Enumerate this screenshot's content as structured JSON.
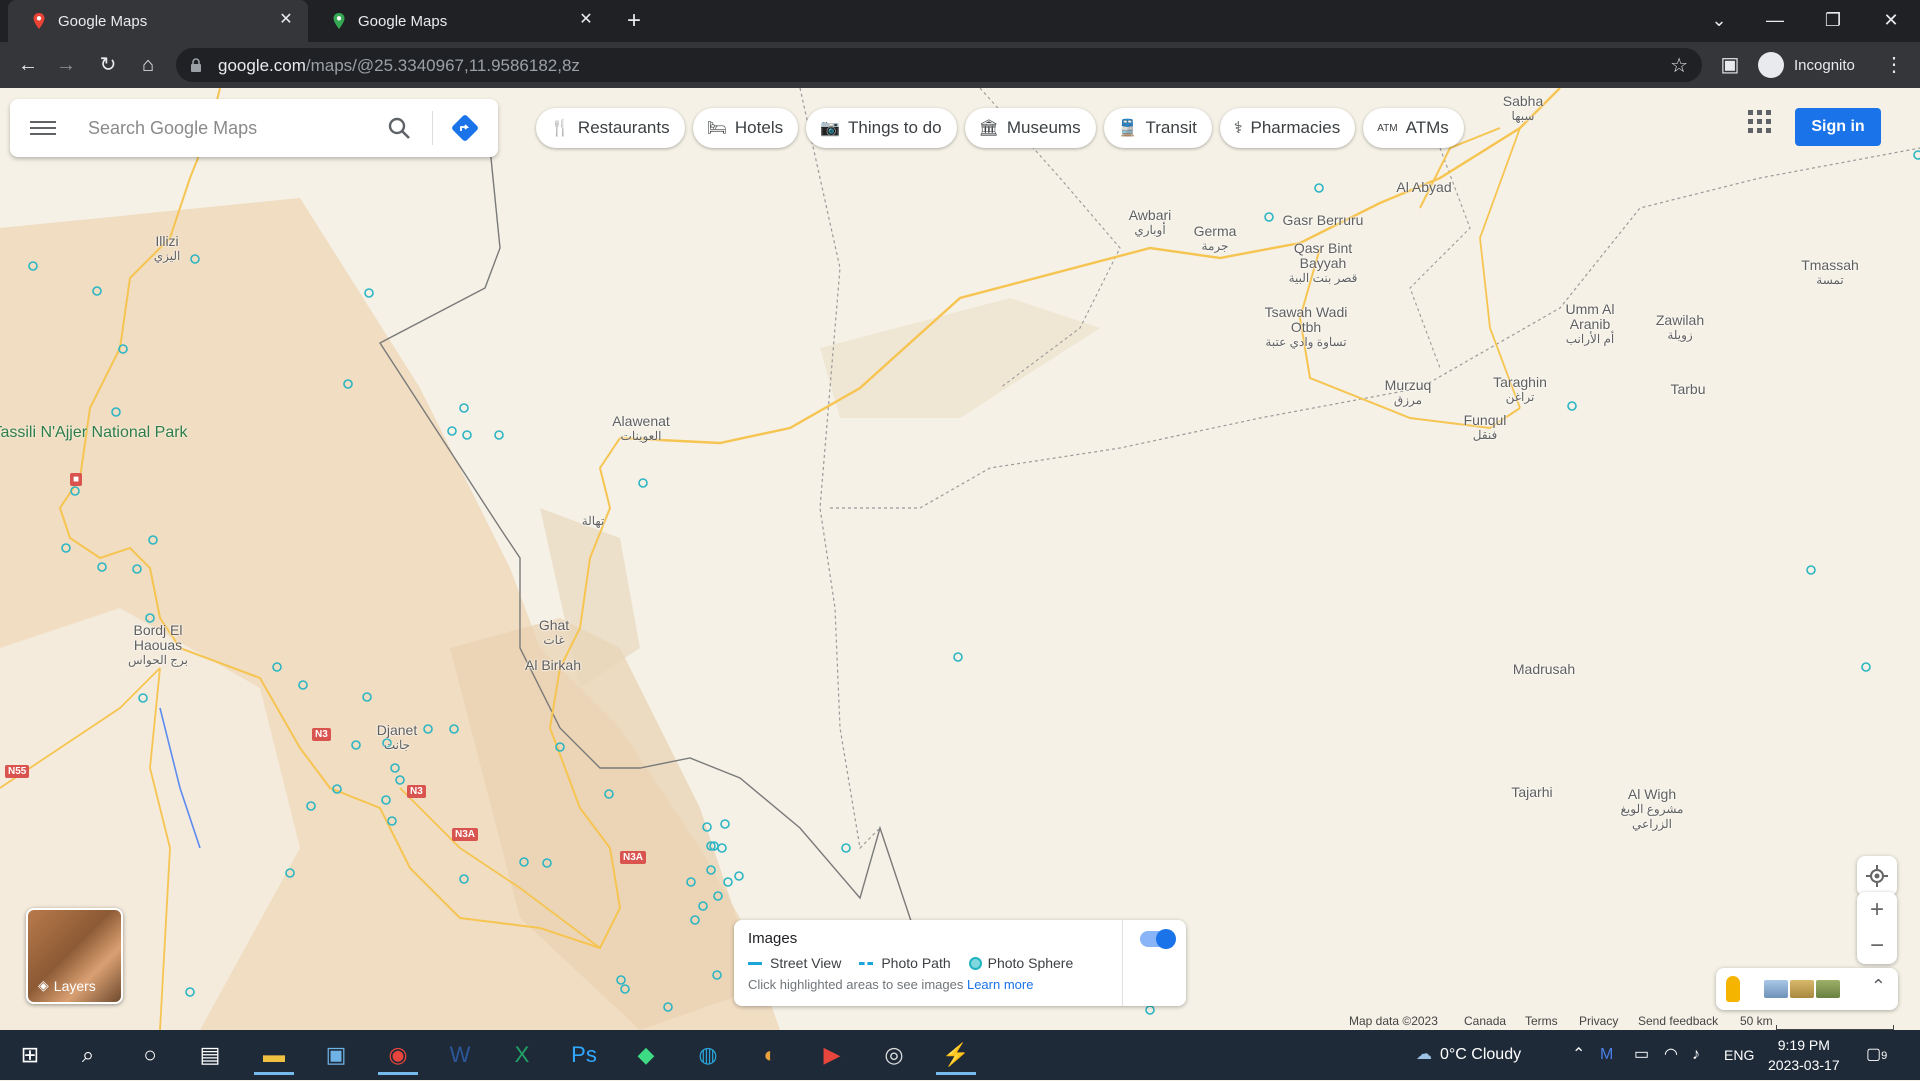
{
  "browser": {
    "tabs": [
      {
        "title": "Google Maps",
        "favicon": "google-maps-pin-icon"
      },
      {
        "title": "Google Maps",
        "favicon": "google-maps-pin-icon"
      }
    ],
    "url_host": "google.com",
    "url_path": "/maps/@25.3340967,11.9586182,8z",
    "incognito_label": "Incognito"
  },
  "search": {
    "placeholder": "Search Google Maps"
  },
  "chips": [
    {
      "label": "Restaurants",
      "icon": "fork-knife-icon"
    },
    {
      "label": "Hotels",
      "icon": "bed-icon"
    },
    {
      "label": "Things to do",
      "icon": "camera-icon"
    },
    {
      "label": "Museums",
      "icon": "museum-icon"
    },
    {
      "label": "Transit",
      "icon": "train-icon"
    },
    {
      "label": "Pharmacies",
      "icon": "pharmacy-icon"
    },
    {
      "label": "ATMs",
      "icon": "atm-icon"
    }
  ],
  "signin_label": "Sign in",
  "map": {
    "park": "Tassili N'Ajjer National Park",
    "places": [
      {
        "name": "Sabha",
        "ar": "سبها"
      },
      {
        "name": "Al Abyad",
        "ar": ""
      },
      {
        "name": "Awbari",
        "ar": "أوباري"
      },
      {
        "name": "Germa",
        "ar": "جرمة"
      },
      {
        "name": "Gasr Berruru",
        "ar": ""
      },
      {
        "name": "Qasr Bint Bayyah",
        "ar": "قصر بنت البية"
      },
      {
        "name": "Tsawah Wadi Otbh",
        "ar": "تساوة وادي عتبة"
      },
      {
        "name": "Murzuq",
        "ar": "مرزق"
      },
      {
        "name": "Taraghin",
        "ar": "تراغن"
      },
      {
        "name": "Funqul",
        "ar": "فنقل"
      },
      {
        "name": "Umm Al Aranib",
        "ar": "أم الأرانب"
      },
      {
        "name": "Zawilah",
        "ar": "زويلة"
      },
      {
        "name": "Tmassah",
        "ar": "تمسة"
      },
      {
        "name": "Tarbu",
        "ar": ""
      },
      {
        "name": "Illizi",
        "ar": "اليزي"
      },
      {
        "name": "Alawenat",
        "ar": "العوينات"
      },
      {
        "name": "",
        "ar": "تهالة"
      },
      {
        "name": "Ghat",
        "ar": "غات"
      },
      {
        "name": "Al Birkah",
        "ar": ""
      },
      {
        "name": "Bordj El Haouas",
        "ar": "برج الحواس"
      },
      {
        "name": "Djanet",
        "ar": "جانت"
      },
      {
        "name": "Madrusah",
        "ar": ""
      },
      {
        "name": "Tajarhi",
        "ar": ""
      },
      {
        "name": "Al Wigh",
        "ar": "مشروع الويغ الزراعي"
      }
    ],
    "road_shields": [
      "N3",
      "N3",
      "N3A",
      "N3A",
      "N55"
    ]
  },
  "layers_label": "Layers",
  "images_panel": {
    "title": "Images",
    "legend": [
      "Street View",
      "Photo Path",
      "Photo Sphere"
    ],
    "hint": "Click highlighted areas to see images",
    "learn_more": "Learn more",
    "toggle_on": true
  },
  "attribution": {
    "map_data": "Map data ©2023",
    "country": "Canada",
    "terms": "Terms",
    "privacy": "Privacy",
    "feedback": "Send feedback",
    "scale": "50 km"
  },
  "taskbar": {
    "weather": "0°C  Cloudy",
    "lang": "ENG",
    "time": "9:19 PM",
    "date": "2023-03-17",
    "notifications": "9"
  }
}
